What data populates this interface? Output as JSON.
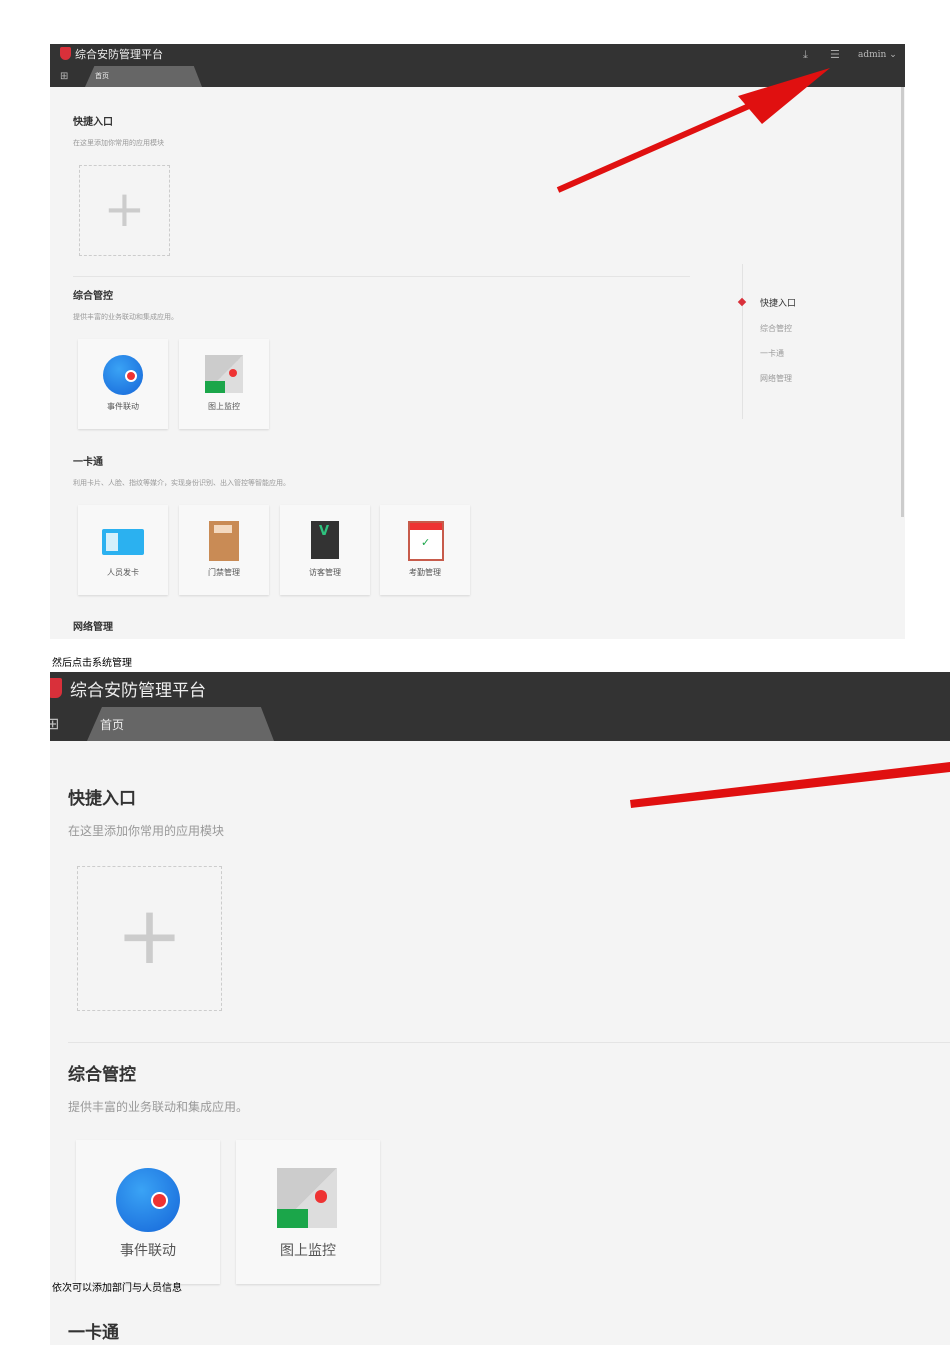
{
  "app": {
    "title": "综合安防管理平台",
    "tab_home": "首页",
    "grid_icon": "⊞",
    "download_icon": "⤓",
    "menu_icon": "☰",
    "user": "admin ⌄"
  },
  "sections": {
    "quick": {
      "title": "快捷入口",
      "subtitle": "在这里添加你常用的应用模块",
      "add": "+"
    },
    "integrated": {
      "title": "综合管控",
      "subtitle": "提供丰富的业务联动和集成应用。",
      "cards": [
        "事件联动",
        "图上监控"
      ]
    },
    "card": {
      "title": "一卡通",
      "subtitle": "利用卡片、人脸、指纹等媒介，实现身份识别、出入管控等智能应用。",
      "cards": [
        "人员发卡",
        "门禁管理",
        "访客管理",
        "考勤管理"
      ]
    },
    "network": {
      "title": "网络管理"
    }
  },
  "right_nav": [
    "快捷入口",
    "综合管控",
    "一卡通",
    "网络管理"
  ],
  "captions": [
    "然后点击系统管理",
    "依次可以添加部门与人员信息"
  ],
  "colors": {
    "header": "#333333",
    "accent": "#d9303a",
    "arrow": "#e01010"
  }
}
